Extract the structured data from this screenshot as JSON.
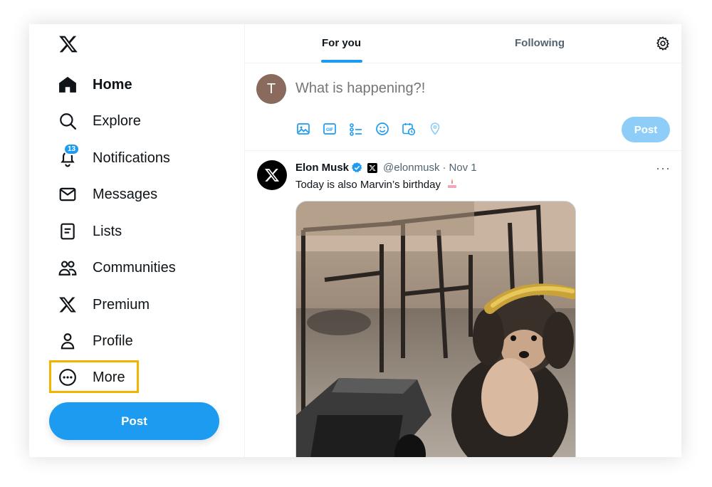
{
  "app": {
    "name": "X"
  },
  "sidebar": {
    "items": [
      {
        "label": "Home",
        "icon": "home-icon",
        "active": true
      },
      {
        "label": "Explore",
        "icon": "search-icon"
      },
      {
        "label": "Notifications",
        "icon": "bell-icon",
        "badge": "13"
      },
      {
        "label": "Messages",
        "icon": "envelope-icon"
      },
      {
        "label": "Lists",
        "icon": "list-icon"
      },
      {
        "label": "Communities",
        "icon": "people-icon"
      },
      {
        "label": "Premium",
        "icon": "x-logo-icon"
      },
      {
        "label": "Profile",
        "icon": "person-icon"
      },
      {
        "label": "More",
        "icon": "more-circle-icon",
        "highlighted": true
      }
    ],
    "post_label": "Post"
  },
  "tabs": [
    {
      "label": "For you",
      "active": true
    },
    {
      "label": "Following"
    }
  ],
  "composer": {
    "avatar_letter": "T",
    "placeholder": "What is happening?!",
    "tools": [
      "image-icon",
      "gif-icon",
      "poll-icon",
      "emoji-icon",
      "schedule-icon",
      "location-icon"
    ],
    "post_label": "Post"
  },
  "tweet": {
    "name": "Elon Musk",
    "handle": "@elonmusk",
    "separator": "·",
    "date": "Nov 1",
    "text": "Today is also Marvin’s birthday",
    "more": "···"
  },
  "colors": {
    "accent": "#1d9bf0",
    "highlight": "#f5b301",
    "text": "#0f1419",
    "muted": "#536471"
  }
}
